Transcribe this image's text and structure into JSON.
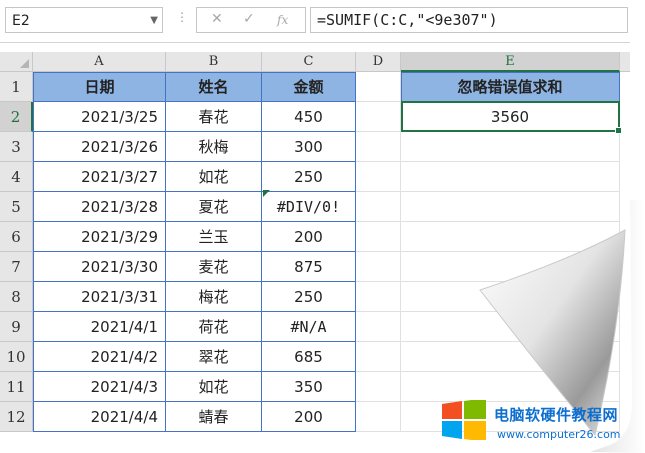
{
  "formula_bar": {
    "name_box": "E2",
    "dots": "⋮",
    "cancel_glyph": "✕",
    "enter_glyph": "✓",
    "fx_glyph": "fx",
    "formula": "=SUMIF(C:C,\"<9e307\")"
  },
  "columns": [
    "A",
    "B",
    "C",
    "D",
    "E"
  ],
  "rows": [
    "1",
    "2",
    "3",
    "4",
    "5",
    "6",
    "7",
    "8",
    "9",
    "10",
    "11",
    "12"
  ],
  "table": {
    "headers": [
      "日期",
      "姓名",
      "金额"
    ],
    "data": [
      [
        "2021/3/25",
        "春花",
        "450"
      ],
      [
        "2021/3/26",
        "秋梅",
        "300"
      ],
      [
        "2021/3/27",
        "如花",
        "250"
      ],
      [
        "2021/3/28",
        "夏花",
        "#DIV/0!"
      ],
      [
        "2021/3/29",
        "兰玉",
        "200"
      ],
      [
        "2021/3/30",
        "麦花",
        "875"
      ],
      [
        "2021/3/31",
        "梅花",
        "250"
      ],
      [
        "2021/4/1",
        "荷花",
        "#N/A"
      ],
      [
        "2021/4/2",
        "翠花",
        "685"
      ],
      [
        "2021/4/3",
        "如花",
        "350"
      ],
      [
        "2021/4/4",
        "蜻春",
        "200"
      ]
    ]
  },
  "result": {
    "header": "忽略错误值求和",
    "value": "3560"
  },
  "watermark": {
    "title": "电脑软硬件教程网",
    "url": "www.computer26.com",
    "colors": [
      "#f25022",
      "#7fba00",
      "#00a4ef",
      "#ffb900"
    ]
  }
}
